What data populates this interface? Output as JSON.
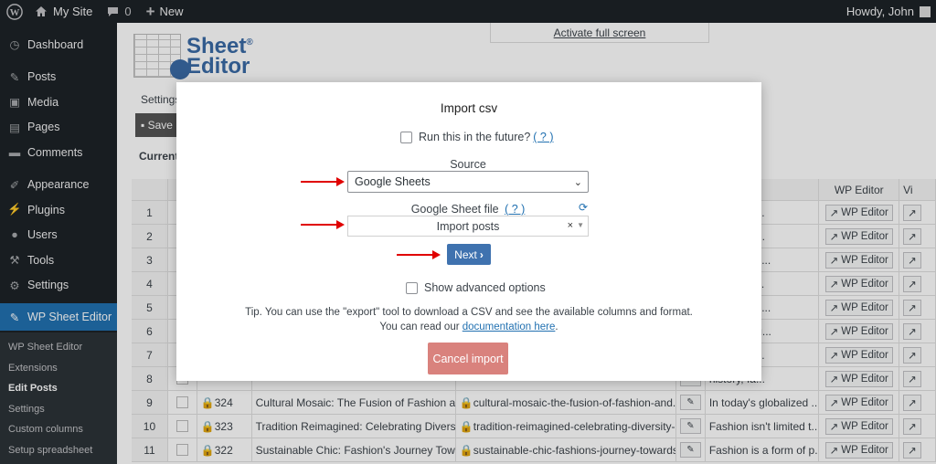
{
  "adminbar": {
    "site_name": "My Site",
    "comments_count": "0",
    "new_label": "New",
    "howdy": "Howdy, John"
  },
  "sidebar": {
    "items": [
      {
        "label": "Dashboard",
        "icon": "dashboard-icon"
      },
      {
        "label": "Posts",
        "icon": "pin-icon"
      },
      {
        "label": "Media",
        "icon": "media-icon"
      },
      {
        "label": "Pages",
        "icon": "pages-icon"
      },
      {
        "label": "Comments",
        "icon": "comment-icon"
      },
      {
        "label": "Appearance",
        "icon": "brush-icon"
      },
      {
        "label": "Plugins",
        "icon": "plugin-icon"
      },
      {
        "label": "Users",
        "icon": "user-icon"
      },
      {
        "label": "Tools",
        "icon": "wrench-icon"
      },
      {
        "label": "Settings",
        "icon": "settings-icon"
      }
    ],
    "active": {
      "label": "WP Sheet Editor",
      "icon": "sheet-editor-icon"
    },
    "submenu": [
      "WP Sheet Editor",
      "Extensions",
      "Edit Posts",
      "Settings",
      "Custom columns",
      "Setup spreadsheet"
    ]
  },
  "main": {
    "logo_line1": "Sheet",
    "logo_line2": "Editor",
    "logo_mark": "®",
    "fullscreen": "Activate full screen",
    "settings_tab": "Settings",
    "save_label": "Save",
    "current_label": "Current",
    "headers": {
      "content": "nt",
      "wp_editor": "WP Editor",
      "vi": "Vi"
    },
    "wp_editor_btn": "WP Editor",
    "rows": [
      {
        "num": "1",
        "id": "",
        "title": "",
        "slug": "",
        "content": "an ever-e..."
      },
      {
        "num": "2",
        "id": "",
        "title": "",
        "slug": "",
        "content": "t history, f..."
      },
      {
        "num": "3",
        "id": "",
        "title": "",
        "slug": "",
        "content": "globalized ..."
      },
      {
        "num": "4",
        "id": "",
        "title": "",
        "slug": "",
        "content": "'t limited t..."
      },
      {
        "num": "5",
        "id": "",
        "title": "",
        "slug": "",
        "content": "a form of p..."
      },
      {
        "num": "6",
        "id": "",
        "title": "",
        "slug": "",
        "content": "y tied to cu..."
      },
      {
        "num": "7",
        "id": "",
        "title": "",
        "slug": "",
        "content": "an ever-e..."
      },
      {
        "num": "8",
        "id": "",
        "title": "",
        "slug": "",
        "content": "history, fa..."
      },
      {
        "num": "9",
        "id": "324",
        "title": "Cultural Mosaic: The Fusion of Fashion an...",
        "slug": "cultural-mosaic-the-fusion-of-fashion-and...",
        "content": "In today's globalized ..."
      },
      {
        "num": "10",
        "id": "323",
        "title": "Tradition Reimagined: Celebrating Diversit...",
        "slug": "tradition-reimagined-celebrating-diversity-...",
        "content": "Fashion isn't limited t..."
      },
      {
        "num": "11",
        "id": "322",
        "title": "Sustainable Chic: Fashion's Journey Towar...",
        "slug": "sustainable-chic-fashions-journey-towards...",
        "content": "Fashion is a form of p..."
      }
    ]
  },
  "modal": {
    "title": "Import csv",
    "future_label": "Run this in the future?",
    "help_link": "( ? )",
    "source_label": "Source",
    "source_value": "Google Sheets",
    "sheet_file_label": "Google Sheet file",
    "sheet_file_value": "Import posts",
    "clear": "×",
    "next_label": "Next",
    "advanced_label": "Show advanced options",
    "tip_line1": "Tip. You can use the \"export\" tool to download a CSV and see the available columns and format.",
    "tip_line2_prefix": "You can read our",
    "tip_link": "documentation here",
    "tip_line2_suffix": ".",
    "cancel_label": "Cancel import"
  },
  "colors": {
    "adminbar": "#1d2327",
    "active_menu": "#2271b1",
    "next_button": "#3f72af",
    "cancel_button": "#d9827d",
    "arrow": "#e00000"
  }
}
